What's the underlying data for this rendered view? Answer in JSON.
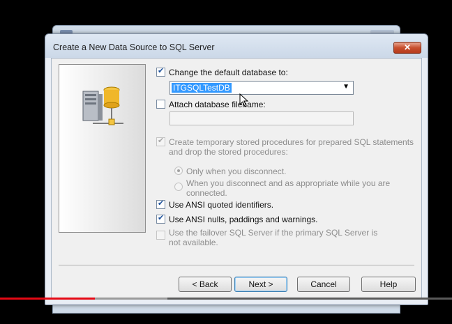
{
  "window": {
    "title": "Create a New Data Source to SQL Server",
    "close_glyph": "✕"
  },
  "options": {
    "change_default_db": {
      "label": "Change the default database to:",
      "checked": true
    },
    "database_value": "ITGSQLTestDB",
    "attach_db_file": {
      "label": "Attach database filename:",
      "checked": false
    },
    "create_temp_procs": {
      "label": "Create temporary stored procedures for prepared SQL statements and drop the stored procedures:",
      "checked": true,
      "enabled": false
    },
    "radio_only_disconnect": {
      "label": "Only when you disconnect.",
      "selected": true
    },
    "radio_disconnect_and_appropriate": {
      "label": "When you disconnect and as appropriate while you are connected.",
      "selected": false
    },
    "ansi_quoted": {
      "label": "Use ANSI quoted identifiers.",
      "checked": true
    },
    "ansi_nulls": {
      "label": "Use ANSI nulls, paddings and warnings.",
      "checked": true
    },
    "failover": {
      "label": "Use the failover SQL Server if the primary SQL Server is not available.",
      "checked": false,
      "enabled": false
    }
  },
  "buttons": {
    "back": "< Back",
    "next": "Next >",
    "cancel": "Cancel",
    "help": "Help"
  },
  "icons": {
    "server": "server-database-icon",
    "dropdown": "chevron-down-icon",
    "close": "close-icon",
    "cursor": "mouse-pointer-icon"
  },
  "colors": {
    "selection": "#3399ff",
    "close_button": "#c8502f",
    "video_progress": "#e50914"
  },
  "video_progress": {
    "played_fraction": 0.21,
    "buffered_fraction": 0.37
  }
}
